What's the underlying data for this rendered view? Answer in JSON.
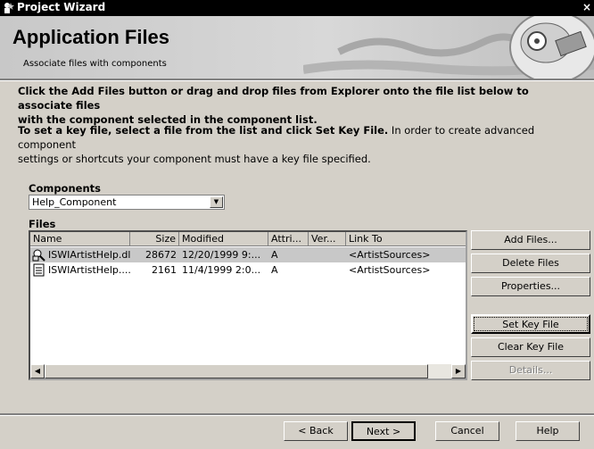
{
  "window": {
    "title": "Project Wizard",
    "close_glyph": "×"
  },
  "header": {
    "title": "Application Files",
    "subtitle": "Associate files with components"
  },
  "instructions": {
    "line1": "Click the Add Files button or drag and drop files from Explorer onto the file list below to associate files",
    "line2": "with the component selected in the component list.",
    "keyfile_bold": "To set a key file, select a file from the list and click Set Key File.",
    "keyfile_rest": " In order to create advanced component",
    "keyfile_line2": "settings or shortcuts your component must have a key file specified."
  },
  "components": {
    "label": "Components",
    "selected": "Help_Component"
  },
  "files": {
    "label": "Files",
    "columns": [
      "Name",
      "Size",
      "Modified",
      "Attri...",
      "Ver...",
      "Link To"
    ],
    "rows": [
      {
        "name": "ISWIArtistHelp.dll",
        "size": "28672",
        "modified": "12/20/1999 9:...",
        "attr": "A",
        "ver": "",
        "link": "<ArtistSources>",
        "icon": "key-file-icon"
      },
      {
        "name": "ISWIArtistHelp....",
        "size": "2161",
        "modified": "11/4/1999 2:0...",
        "attr": "A",
        "ver": "",
        "link": "<ArtistSources>",
        "icon": "document-icon"
      }
    ]
  },
  "side_buttons": {
    "add": "Add Files...",
    "delete": "Delete Files",
    "properties": "Properties...",
    "set_key": "Set Key File",
    "clear_key": "Clear Key File",
    "details": "Details..."
  },
  "nav": {
    "back": "< Back",
    "next": "Next >",
    "cancel": "Cancel",
    "help": "Help"
  }
}
